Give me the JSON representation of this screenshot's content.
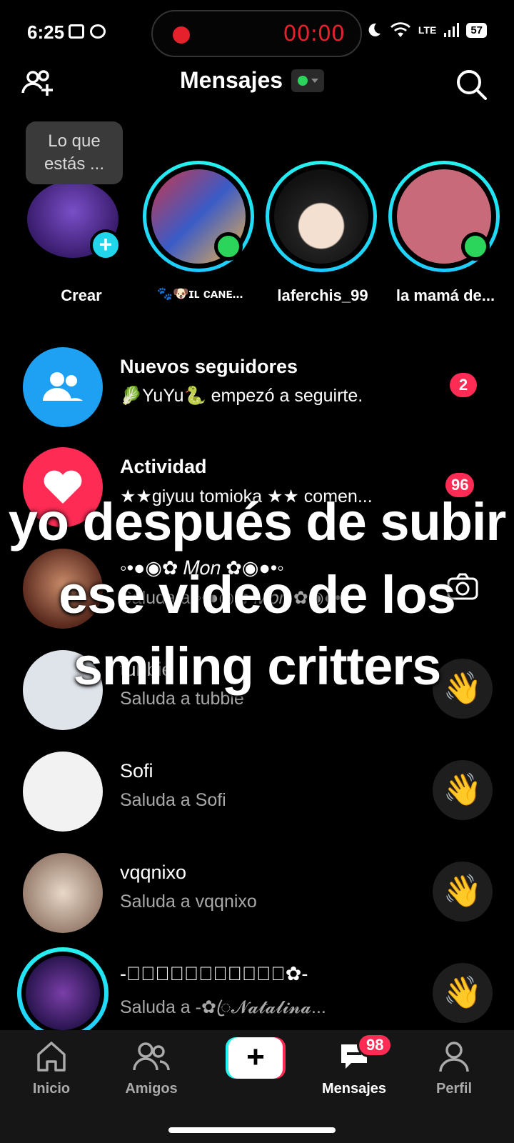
{
  "status_bar": {
    "time": "6:25",
    "recording_time": "00:00",
    "network": "LTE",
    "battery": "57"
  },
  "header": {
    "title": "Mensajes"
  },
  "tooltip": {
    "text": "Lo que estás ..."
  },
  "stories": [
    {
      "name": "Crear"
    },
    {
      "name": "🐾🐶ɪʟ ᴄᴀɴᴇ..."
    },
    {
      "name": "laferchis_99"
    },
    {
      "name": "la mamá de..."
    }
  ],
  "notifications": [
    {
      "title": "Nuevos seguidores",
      "subtitle": "🥬YuYu🐍 empezó a seguirte.",
      "badge": "2"
    },
    {
      "title": "Actividad",
      "subtitle": "★★giyuu tomioka ★★ comen...",
      "badge": "96"
    }
  ],
  "conversations": [
    {
      "name": "◦•●◉✿ 𝑀𝑜𝑛 ✿◉●•◦",
      "subtitle": "Saluda a ◦•●◉✿ 𝑀𝑜𝑛 ✿◉●•◦"
    },
    {
      "name": "tubbie",
      "subtitle": "Saluda a tubbie"
    },
    {
      "name": "Sofi",
      "subtitle": "Saluda a Sofi"
    },
    {
      "name": "vqqnixo",
      "subtitle": "Saluda a vqqnixo"
    },
    {
      "name": "-✿ꦿ𝓝𝓪𝓽𝓪𝓵𝓲𝓷𝓪ꦿ✿-",
      "subtitle": "Saluda a -✿ꦿ𝓝𝓪𝓽𝓪𝓵𝓲𝓷𝓪..."
    }
  ],
  "caption": {
    "line1": "yo después de subir",
    "line2": "ese video de los",
    "line3": "smiling critters"
  },
  "nav": {
    "home": "Inicio",
    "friends": "Amigos",
    "messages": "Mensajes",
    "messages_badge": "98",
    "profile": "Perfil"
  },
  "colors": {
    "accent": "#fe2c55",
    "cyan": "#25f4ee",
    "online": "#2bd45b",
    "follower_blue": "#1ea1f2"
  }
}
